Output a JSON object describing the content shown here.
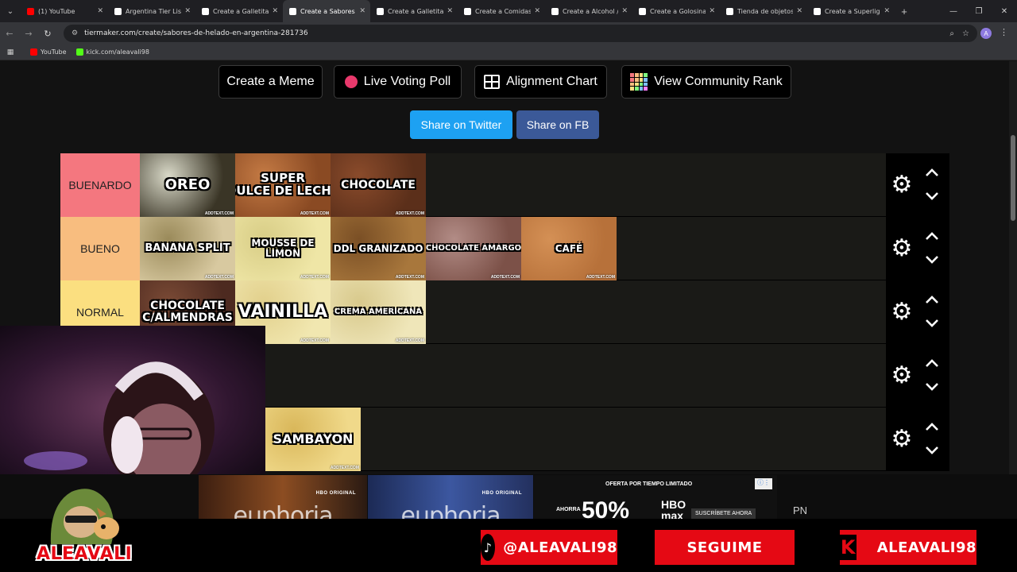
{
  "browser": {
    "tabs": [
      {
        "title": "(1) YouTube",
        "fav": "#ff0000",
        "active": false
      },
      {
        "title": "Argentina Tier Lis",
        "fav": "#ffffff",
        "active": false
      },
      {
        "title": "Create a Galletitas",
        "fav": "#ffffff",
        "active": false
      },
      {
        "title": "Create a Sabores",
        "fav": "#ffffff",
        "active": true
      },
      {
        "title": "Create a Galletitas",
        "fav": "#ffffff",
        "active": false
      },
      {
        "title": "Create a Comidas",
        "fav": "#ffffff",
        "active": false
      },
      {
        "title": "Create a Alcohol /",
        "fav": "#ffffff",
        "active": false
      },
      {
        "title": "Create a Golosinas",
        "fav": "#ffffff",
        "active": false
      },
      {
        "title": "Tienda de objetos",
        "fav": "#ffffff",
        "active": false
      },
      {
        "title": "Create a Superlig",
        "fav": "#ffffff",
        "active": false
      }
    ],
    "url": "tiermaker.com/create/sabores-de-helado-en-argentina-281736",
    "profile_initial": "A",
    "bookmarks": [
      {
        "label": "YouTube",
        "fav": "#ff0000"
      },
      {
        "label": "kick.com/aleavali98",
        "fav": "#53fc18"
      }
    ]
  },
  "toolbar": {
    "create_meme": "Create a Meme",
    "live_poll": "Live Voting Poll",
    "alignment": "Alignment Chart",
    "community": "View Community Rank",
    "share_twitter": "Share on Twitter",
    "share_fb": "Share on FB"
  },
  "colors": {
    "twitter": "#1da1f2",
    "facebook": "#3b5998",
    "accent_red": "#e50914"
  },
  "tiers": [
    {
      "label": "BUENARDO",
      "color": "#f4777f",
      "items": [
        {
          "name": "OREO",
          "bg": "#3a3526",
          "bg2": "#d9d9c8",
          "size": 18
        },
        {
          "name": "SUPER\nDULCE DE LECHE",
          "bg": "#8a4a23",
          "bg2": "#c47a44",
          "size": 15
        },
        {
          "name": "CHOCOLATE",
          "bg": "#5b2f1a",
          "bg2": "#8a4b2b",
          "size": 14
        }
      ]
    },
    {
      "label": "BUENO",
      "color": "#f8bd7f",
      "items": [
        {
          "name": "BANANA SPLIT",
          "bg": "#d8c9a0",
          "bg2": "#9a8a5a",
          "size": 13
        },
        {
          "name": "MOUSSE DE\nLIMON",
          "bg": "#efe6a6",
          "bg2": "#d8cd86",
          "size": 12
        },
        {
          "name": "DDL GRANIZADO",
          "bg": "#a8773c",
          "bg2": "#7a4f25",
          "size": 12
        },
        {
          "name": "CHOCOLATE AMARGO",
          "bg": "#7c5148",
          "bg2": "#b28c86",
          "size": 10
        },
        {
          "name": "CAFÉ",
          "bg": "#b7713a",
          "bg2": "#d49055",
          "size": 12
        }
      ]
    },
    {
      "label": "NORMAL",
      "color": "#fbdf80",
      "items": [
        {
          "name": "CHOCOLATE\nC/ALMENDRAS",
          "bg": "#4d2a20",
          "bg2": "#7a4a35",
          "size": 14
        },
        {
          "name": "VAINILLA",
          "bg": "#f1e7b0",
          "bg2": "#e2d08c",
          "size": 22
        },
        {
          "name": "CREMA AMERICANA",
          "bg": "#efe6b9",
          "bg2": "#d8c98c",
          "size": 10
        }
      ]
    },
    {
      "label": "",
      "color": "#1a1a17",
      "items": []
    },
    {
      "label": "",
      "color": "#1a1a17",
      "items": [
        {
          "name": "SAMBAYON",
          "bg": "#f0d98a",
          "bg2": "#d9b75a",
          "size": 16
        }
      ]
    }
  ],
  "item_watermark": "ADDTEXT.COM",
  "overlay": {
    "brand": "ALEAVALI",
    "ads": [
      {
        "word": "euphoria",
        "hbo": "HBO ORIGINAL"
      },
      {
        "word": "euphoria",
        "hbo": "HBO ORIGINAL"
      }
    ],
    "promo_top": "OFERTA POR TIEMPO LIMITADO",
    "promo_pre": "AHORRA",
    "promo_pct": "50%",
    "promo_brand": "HBO max",
    "promo_cta": "SUSCRÍBETE AHORA",
    "promo_side": "PN",
    "tiktok": "@ALEAVALI98",
    "follow": "SEGUIME",
    "kick": "ALEAVALI98"
  }
}
